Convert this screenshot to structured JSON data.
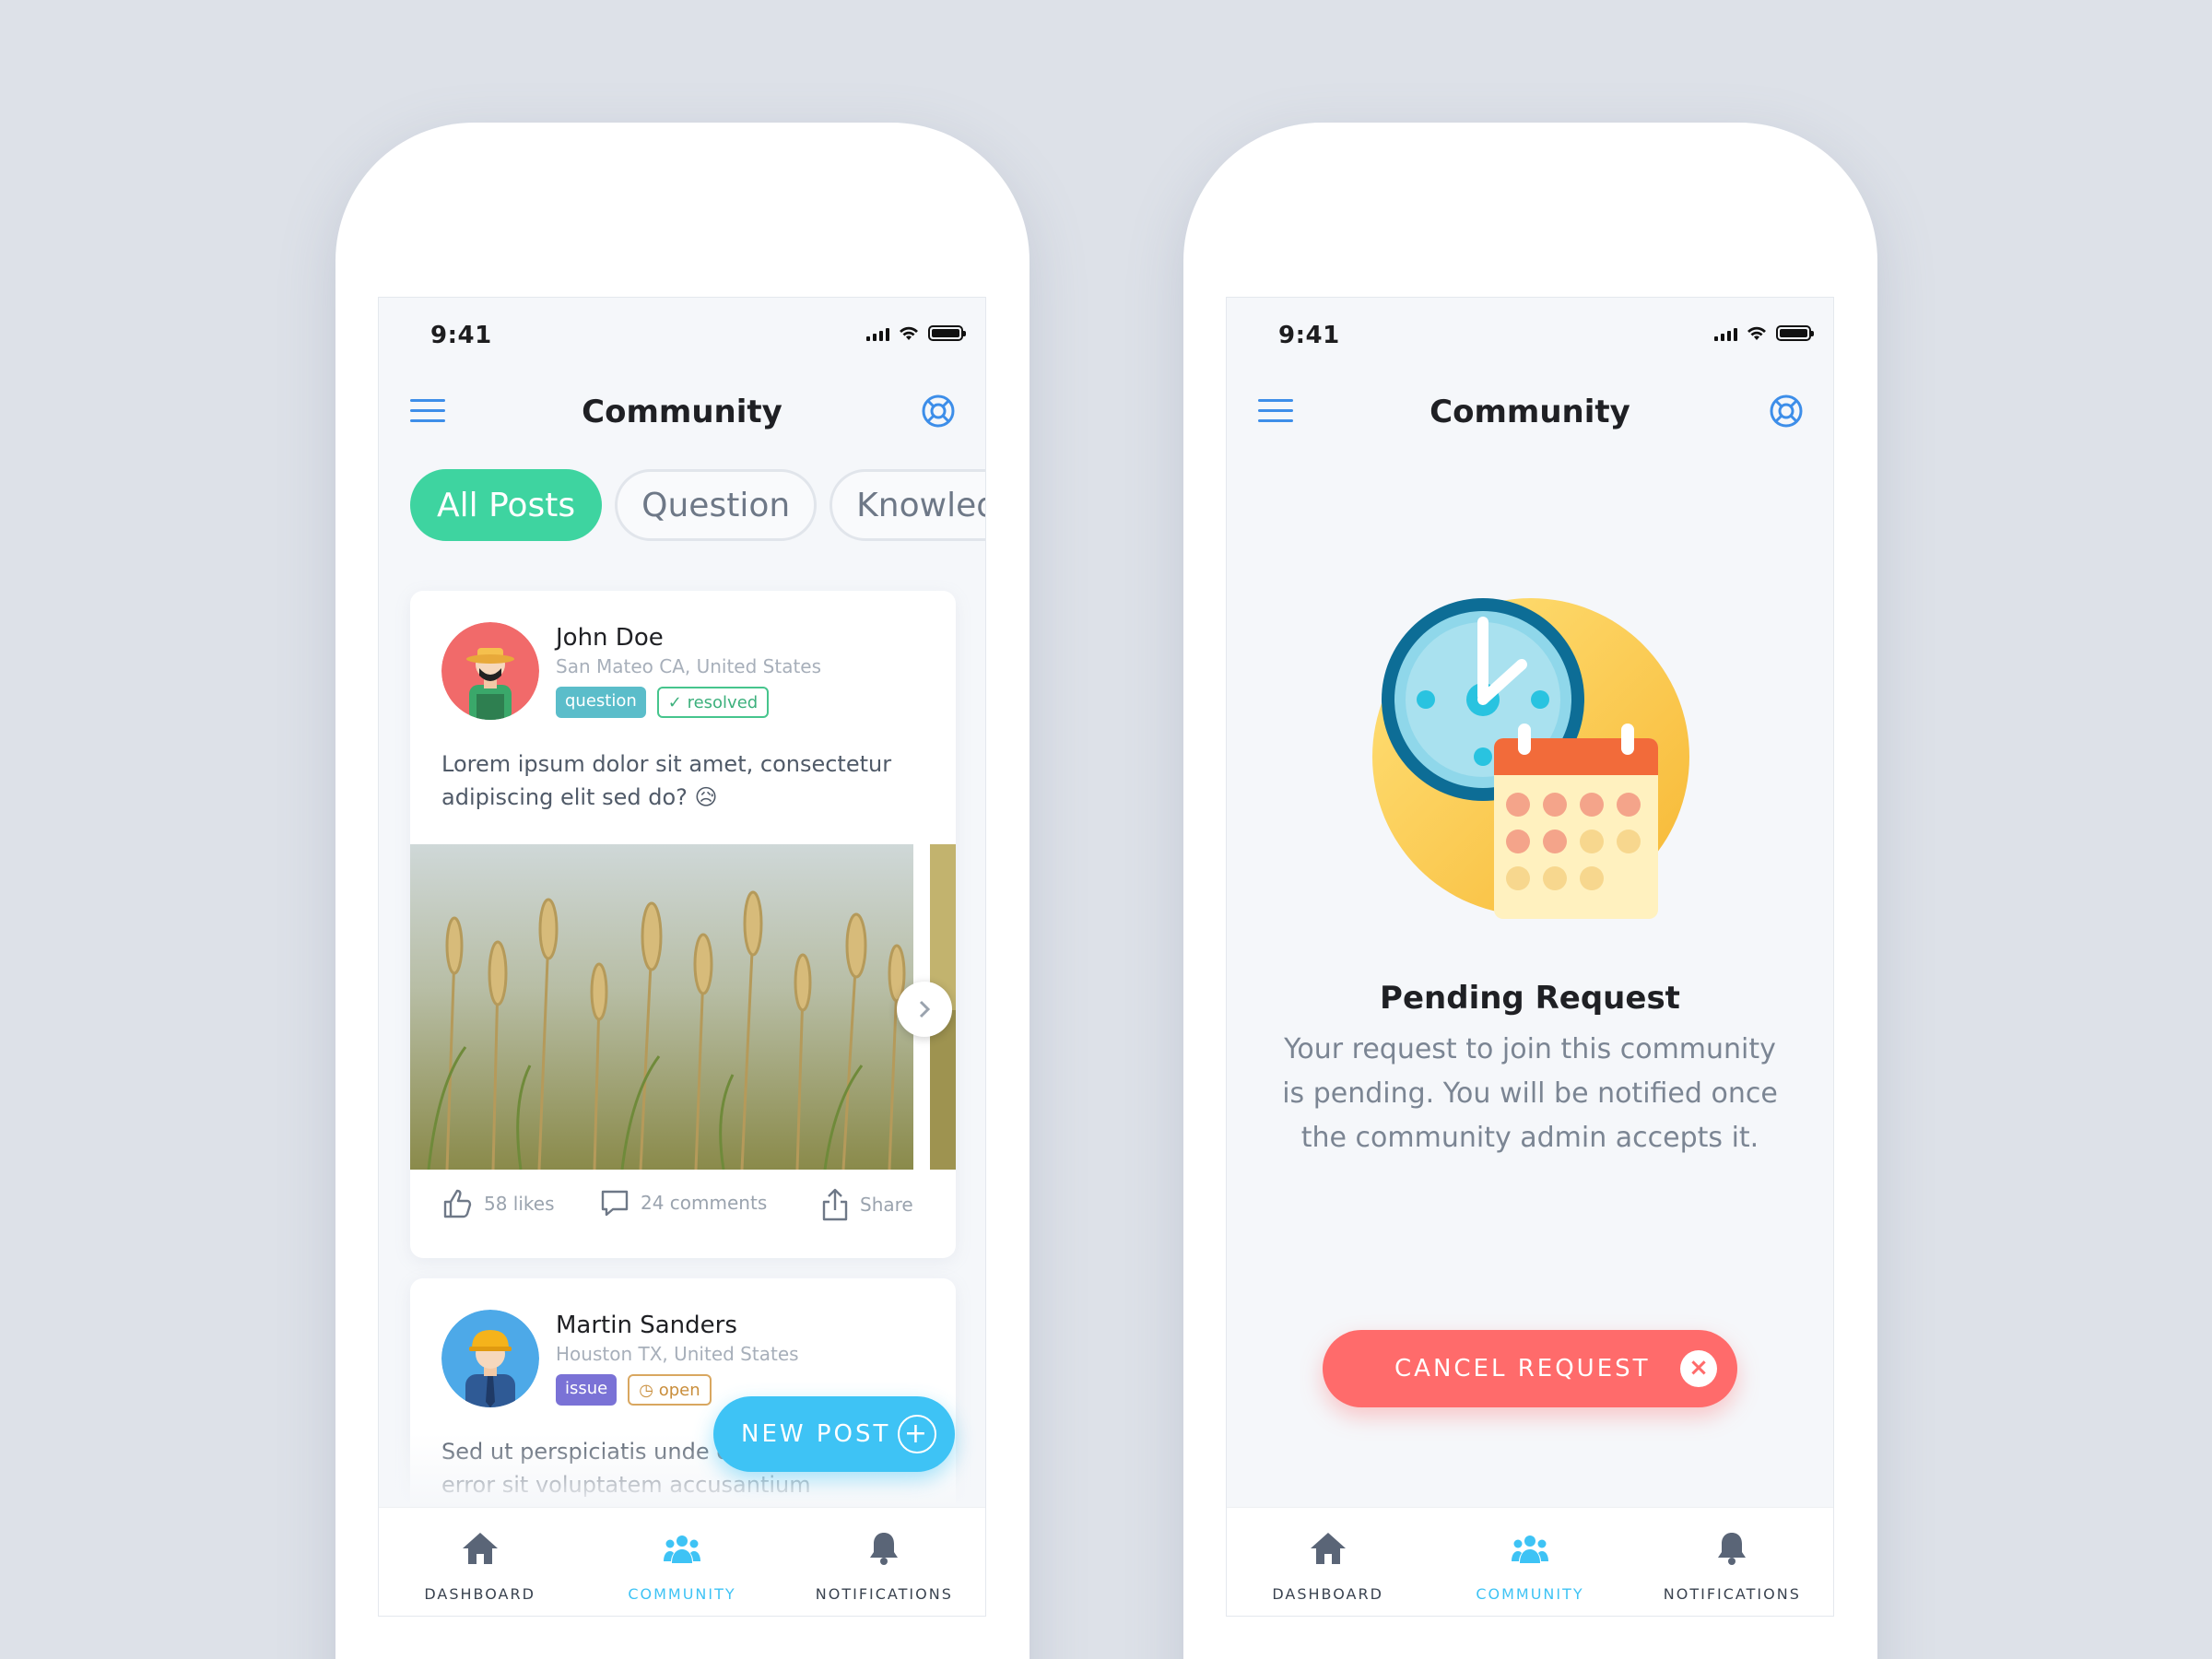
{
  "status_bar": {
    "time": "9:41"
  },
  "header": {
    "title": "Community"
  },
  "tabs": [
    {
      "label": "All Posts",
      "active": true
    },
    {
      "label": "Question",
      "active": false
    },
    {
      "label": "Knowledge",
      "active": false
    }
  ],
  "posts": [
    {
      "author": "John Doe",
      "location": "San Mateo CA, United States",
      "type_badge": "question",
      "status_badge": "resolved",
      "text": "Lorem ipsum dolor sit amet, consectetur adipiscing elit sed do? 😥",
      "likes": "58 likes",
      "comments": "24 comments",
      "share": "Share"
    },
    {
      "author": "Martin Sanders",
      "location": "Houston TX, United States",
      "type_badge": "issue",
      "status_badge": "open",
      "text": "Sed ut perspiciatis unde omnis iste natus error sit voluptatem accusantium"
    }
  ],
  "fab": {
    "label": "NEW POST",
    "plus": "+"
  },
  "tabbar": {
    "dashboard": "DASHBOARD",
    "community": "COMMUNITY",
    "notifications": "NOTIFICATIONS"
  },
  "pending": {
    "title": "Pending Request",
    "body": "Your request to join this community is pending. You will be notified once the community admin accepts it.",
    "cancel_label": "CANCEL REQUEST",
    "cancel_icon": "×"
  },
  "colors": {
    "accent_green": "#3ed4a0",
    "accent_blue": "#3ec3f5",
    "cancel_red": "#ff6b6b",
    "link_blue": "#3d8ee9"
  }
}
